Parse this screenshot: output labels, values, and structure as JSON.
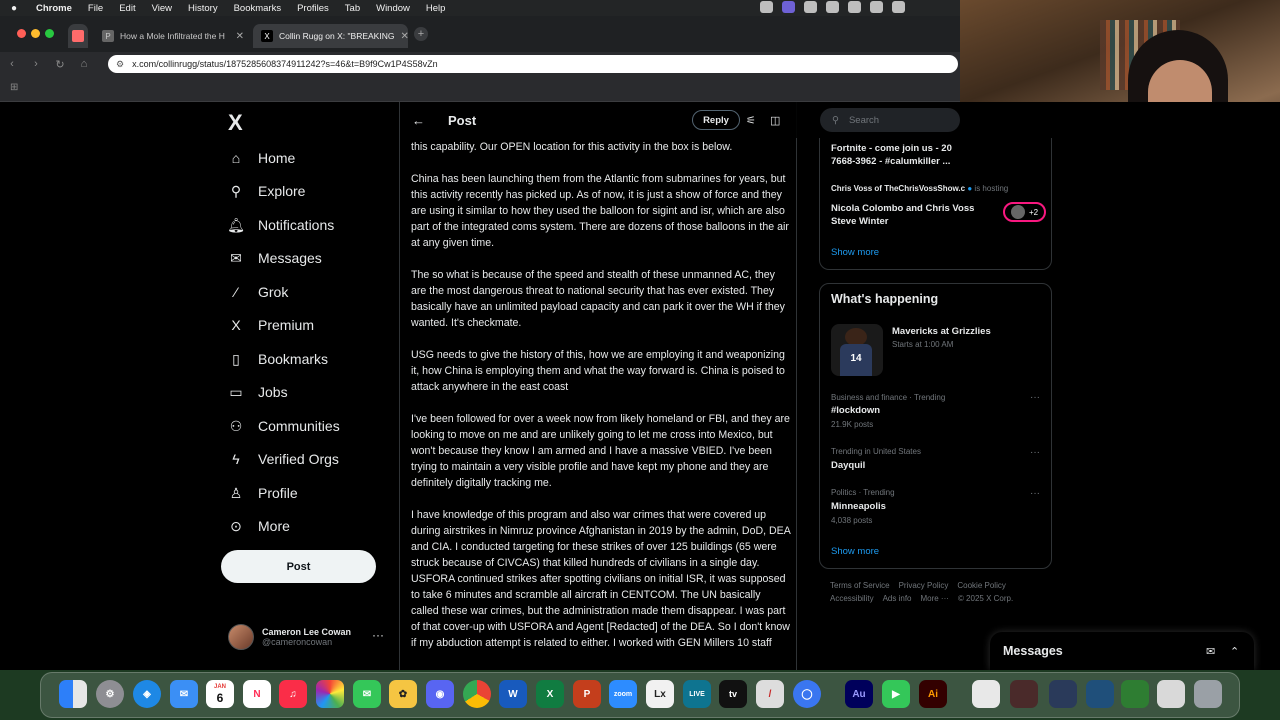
{
  "menubar": {
    "apple": "",
    "items": [
      "Chrome",
      "File",
      "Edit",
      "View",
      "History",
      "Bookmarks",
      "Profiles",
      "Tab",
      "Window",
      "Help"
    ]
  },
  "browser": {
    "tabs": [
      {
        "title": "How a Mole Infiltrated the H"
      },
      {
        "title": "Collin Rugg on X: \"BREAKING"
      }
    ],
    "url": "x.com/collinrugg/status/1875285608374911242?s=46&t=B9f9Cw1P4S58vZn"
  },
  "sidebar": {
    "logo": "X",
    "items": [
      {
        "label": "Home"
      },
      {
        "label": "Explore"
      },
      {
        "label": "Notifications"
      },
      {
        "label": "Messages"
      },
      {
        "label": "Grok"
      },
      {
        "label": "Premium"
      },
      {
        "label": "Bookmarks"
      },
      {
        "label": "Jobs"
      },
      {
        "label": "Communities"
      },
      {
        "label": "Verified Orgs"
      },
      {
        "label": "Profile"
      },
      {
        "label": "More"
      }
    ],
    "post_label": "Post",
    "account": {
      "name": "Cameron Lee Cowan",
      "handle": "@cameroncowan",
      "dots": "···"
    }
  },
  "header": {
    "back": "←",
    "title": "Post",
    "reply_label": "Reply"
  },
  "post": {
    "paragraphs": [
      "this capability. Our OPEN location for this activity in the box is below.",
      "China has been launching them from the Atlantic from submarines for years, but this activity recently has picked up. As of now, it is just a show of force and they are using it similar to how they used the balloon for sigint and isr, which are also part of the integrated coms system. There are dozens of those balloons in the air at any given time.",
      "The so what is because of the speed and stealth of these unmanned AC, they are the most dangerous threat to national security that has ever existed. They basically have an unlimited payload capacity and can park it over the WH if they wanted. It's checkmate.",
      "USG needs to give the history of this, how we are employing it and weaponizing it, how China is employing them and what the way forward is. China is poised to attack anywhere in the east coast",
      "I've been followed for over a week now from likely homeland or FBI, and they are looking to move on me and are unlikely going to let me cross into Mexico, but won't because they know I am armed and I have a massive VBIED. I've been trying to maintain a very visible profile and have kept my phone and they are definitely digitally tracking me.",
      "I have knowledge of this program and also war crimes that were covered up during airstrikes in Nimruz province Afghanistan in 2019 by the admin, DoD, DEA and CIA. I conducted targeting for these strikes of over 125 buildings (65 were struck because of CIVCAS) that killed hundreds of civilians in a single day. USFORA continued strikes after spotting civilians on initial ISR, it was supposed to take 6 minutes and scramble all aircraft in CENTCOM. The UN basically called these war crimes, but the administration made them disappear. I was part of that cover-up with USFORA and Agent [Redacted] of the DEA. So I don't know if my abduction attempt is related to either. I worked with GEN Millers 10 staff"
    ]
  },
  "right": {
    "search_placeholder": "Search",
    "spaces": {
      "title": "Fortnite - come join us - 20 7668-3962 - #calumkiller ...",
      "host": "Chris Voss of TheChrisVossShow.c",
      "host_suffix": "is hosting",
      "speakers": "Nicola Colombo and Chris Voss Steve Winter",
      "extra": "+2",
      "show_more": "Show more"
    },
    "happening": {
      "title": "What's happening",
      "event": {
        "name": "Mavericks at Grizzlies",
        "time": "Starts at 1:00 AM",
        "jersey": "14"
      },
      "trends": [
        {
          "meta": "Business and finance · Trending",
          "name": "#lockdown",
          "posts": "21.9K posts"
        },
        {
          "meta": "Trending in United States",
          "name": "Dayquil",
          "posts": ""
        },
        {
          "meta": "Politics · Trending",
          "name": "Minneapolis",
          "posts": "4,038 posts"
        }
      ],
      "dots": "···",
      "show_more": "Show more"
    },
    "footer": {
      "line1": [
        "Terms of Service",
        "Privacy Policy",
        "Cookie Policy"
      ],
      "line2": [
        "Accessibility",
        "Ads info",
        "More ···",
        "© 2025 X Corp."
      ]
    }
  },
  "messages_drawer": {
    "title": "Messages"
  },
  "dock": {
    "calendar_month": "JAN",
    "calendar_day": "6",
    "apps": [
      "Finder",
      "Settings",
      "Safari",
      "Mail",
      "Calendar",
      "News",
      "Music",
      "Photos",
      "Messages",
      "Tes",
      "Discord",
      "Chrome",
      "Word",
      "Excel",
      "PowerPoint",
      "Zoom",
      "Lx",
      "Live",
      "tv",
      "Pencil",
      "Signal",
      "Au",
      "FaceTime",
      "Ai"
    ]
  },
  "colors": {
    "accent": "#1d9bf0",
    "bg": "#000000",
    "text": "#e7e9ea",
    "muted": "#71767b",
    "border": "#2f3336"
  }
}
